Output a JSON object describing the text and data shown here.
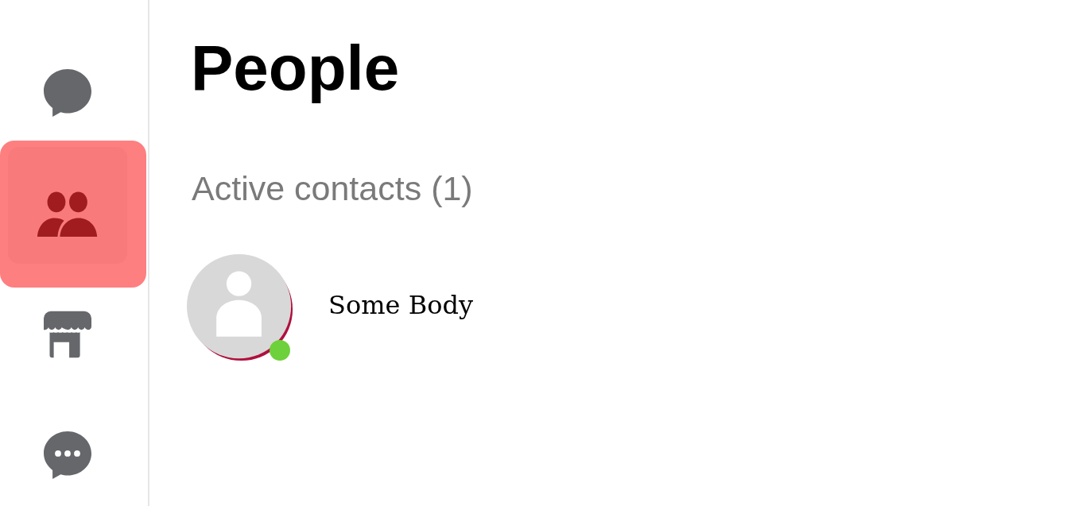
{
  "sidebar": {
    "items": [
      {
        "selected": false
      },
      {
        "selected": true
      },
      {
        "selected": false
      },
      {
        "selected": false
      }
    ]
  },
  "page": {
    "title": "People",
    "section": "Active contacts (1)",
    "contacts": [
      {
        "name": "Some Body",
        "online": true
      }
    ]
  }
}
